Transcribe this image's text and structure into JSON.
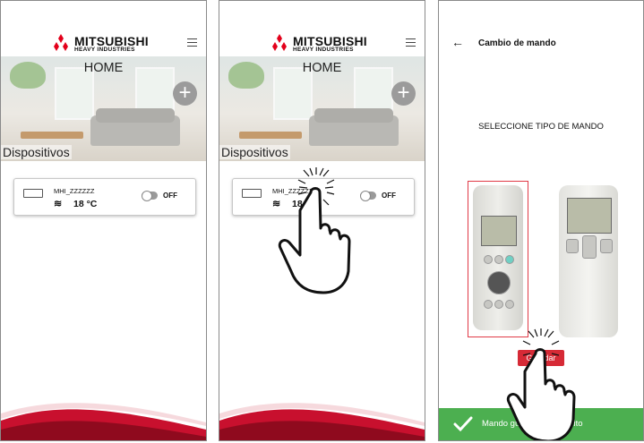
{
  "brand": {
    "name": "MITSUBISHI",
    "sub": "HEAVY INDUSTRIES"
  },
  "home": {
    "title": "HOME",
    "section": "Dispositivos",
    "add_icon": "plus-icon",
    "menu_icon": "hamburger-icon"
  },
  "device": {
    "name": "MHI_ZZZZZZ",
    "mode_icon": "fan-mode-icon",
    "temperature": "18 °C",
    "power_state": "OFF"
  },
  "remote_change": {
    "title": "Cambio de mando",
    "back_icon": "arrow-left-icon",
    "instruction": "SELECCIONE TIPO DE MANDO",
    "save_label": "Guardar",
    "toast": "Mando guardado con éxito"
  },
  "colors": {
    "brand_red": "#d62a36",
    "success_green": "#4caf50",
    "selection_border": "#e03a46"
  }
}
